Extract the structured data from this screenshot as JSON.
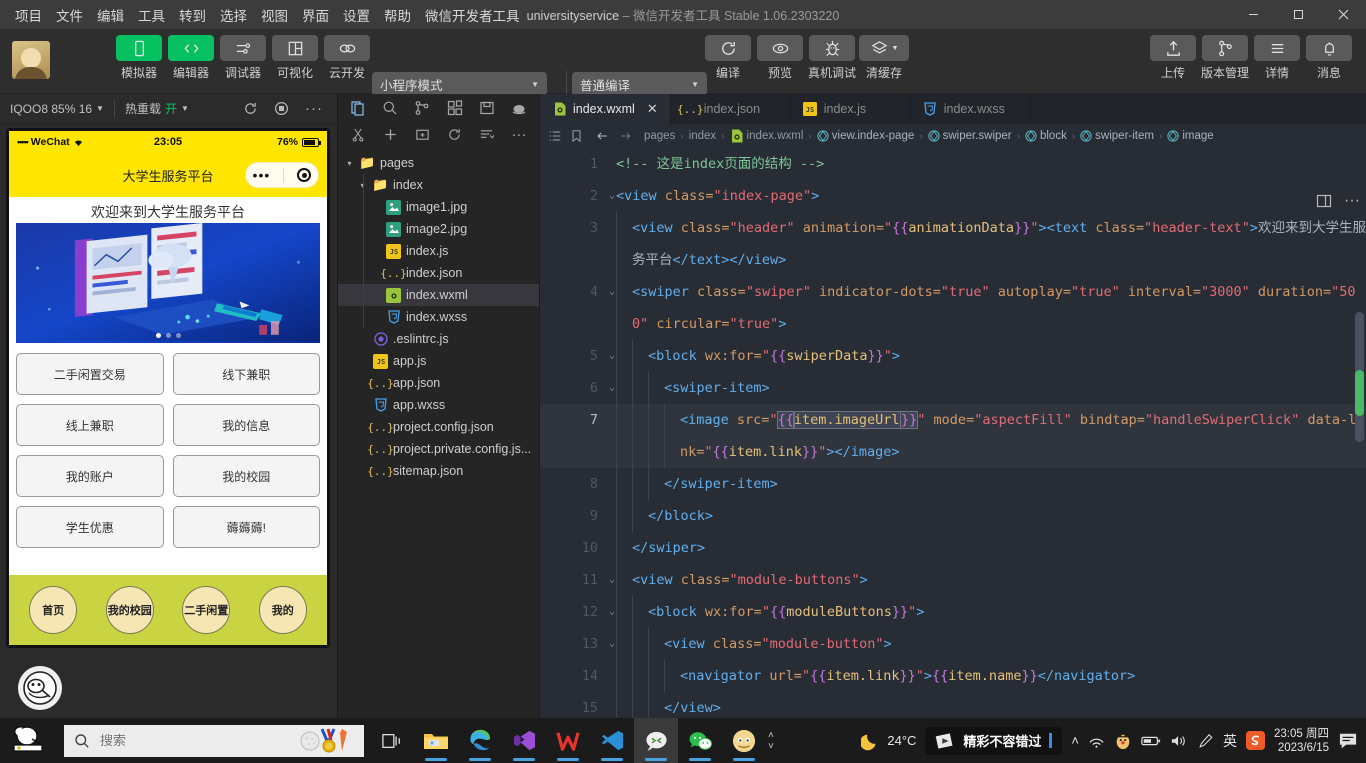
{
  "titlebar": {
    "menus": [
      "项目",
      "文件",
      "编辑",
      "工具",
      "转到",
      "选择",
      "视图",
      "界面",
      "设置",
      "帮助",
      "微信开发者工具"
    ],
    "project_name": "universityservice",
    "dash": "–",
    "app_name": "微信开发者工具",
    "version": "Stable 1.06.2303220",
    "minimize": "–",
    "maximize": "▢",
    "close": "✕"
  },
  "toolbar": {
    "items": [
      {
        "label": "模拟器",
        "icon": "phone-icon",
        "active": true
      },
      {
        "label": "编辑器",
        "icon": "code-icon",
        "active": true
      },
      {
        "label": "调试器",
        "icon": "sliders-icon",
        "active": false
      },
      {
        "label": "可视化",
        "icon": "layout-icon",
        "active": false
      },
      {
        "label": "云开发",
        "icon": "cloud-icon",
        "active": false
      }
    ],
    "mode_select": "小程序模式",
    "compile_select": "普通编译",
    "actions": [
      {
        "label": "编译",
        "icon": "refresh-icon"
      },
      {
        "label": "预览",
        "icon": "eye-icon"
      },
      {
        "label": "真机调试",
        "icon": "bug-icon"
      },
      {
        "label": "清缓存",
        "icon": "layers-icon"
      }
    ],
    "right_actions": [
      {
        "label": "上传",
        "icon": "upload-icon"
      },
      {
        "label": "版本管理",
        "icon": "branch-icon"
      },
      {
        "label": "详情",
        "icon": "menu-icon"
      },
      {
        "label": "消息",
        "icon": "bell-icon"
      }
    ]
  },
  "simulator": {
    "device": "IQOO8 85% 16",
    "hot_reload_label": "热重载",
    "hot_reload_value": "开",
    "icons": [
      "refresh-icon",
      "record-icon",
      "more-icon"
    ],
    "phone": {
      "status_carrier": "WeChat",
      "status_dots": "•••••",
      "status_time": "23:05",
      "battery_percent": "76%",
      "nav_title": "大学生服务平台",
      "welcome_text": "欢迎来到大学生服务平台",
      "swiper_dots": 3,
      "swiper_active": 0,
      "module_buttons": [
        "二手闲置交易",
        "线下兼职",
        "线上兼职",
        "我的信息",
        "我的账户",
        "我的校园",
        "学生优惠",
        "薅薅薅!"
      ],
      "tabbar": [
        "首页",
        "我的校园",
        "二手闲置",
        "我的"
      ]
    }
  },
  "file_tree": {
    "tools_row1": [
      "files-icon",
      "search-icon",
      "branch-icon",
      "extensions-icon",
      "save-icon",
      "debug-icon"
    ],
    "tools_row2": [
      "cut-icon",
      "new-file-icon",
      "new-folder-icon",
      "refresh-icon",
      "collapse-icon",
      "more-icon"
    ],
    "items": [
      {
        "label": "pages",
        "type": "folder",
        "depth": 0,
        "arrow": "▾"
      },
      {
        "label": "index",
        "type": "folder-o",
        "depth": 1,
        "arrow": "▾"
      },
      {
        "label": "image1.jpg",
        "type": "img",
        "depth": 2
      },
      {
        "label": "image2.jpg",
        "type": "img",
        "depth": 2
      },
      {
        "label": "index.js",
        "type": "js",
        "depth": 2
      },
      {
        "label": "index.json",
        "type": "json",
        "depth": 2
      },
      {
        "label": "index.wxml",
        "type": "wxml",
        "depth": 2,
        "active": true
      },
      {
        "label": "index.wxss",
        "type": "wxss",
        "depth": 2
      },
      {
        "label": ".eslintrc.js",
        "type": "eslint",
        "depth": 1
      },
      {
        "label": "app.js",
        "type": "js",
        "depth": 1
      },
      {
        "label": "app.json",
        "type": "json",
        "depth": 1
      },
      {
        "label": "app.wxss",
        "type": "wxss",
        "depth": 1
      },
      {
        "label": "project.config.json",
        "type": "json",
        "depth": 1
      },
      {
        "label": "project.private.config.js...",
        "type": "json",
        "depth": 1
      },
      {
        "label": "sitemap.json",
        "type": "json",
        "depth": 1
      }
    ]
  },
  "editor": {
    "tabs": [
      {
        "label": "index.wxml",
        "type": "wxml",
        "active": true,
        "close": "✕"
      },
      {
        "label": "index.json",
        "type": "json",
        "active": false
      },
      {
        "label": "index.js",
        "type": "js",
        "active": false
      },
      {
        "label": "index.wxss",
        "type": "wxss",
        "active": false
      }
    ],
    "breadcrumb_icons": [
      "outline-icon",
      "bookmark-icon",
      "back-arrow-icon",
      "forward-arrow-icon"
    ],
    "breadcrumb": [
      "pages",
      "index",
      "index.wxml",
      "view.index-page",
      "swiper.swiper",
      "block",
      "swiper-item",
      "image"
    ],
    "right_icons": [
      "split-editor-icon",
      "more-icon"
    ],
    "code_lines": [
      {
        "num": "1",
        "fold": "",
        "indent": 0,
        "highlight": false,
        "spans": [
          {
            "t": "<!-- ",
            "c": "t-com"
          },
          {
            "t": "这是index页面的结构 -->",
            "c": "t-com"
          }
        ]
      },
      {
        "num": "2",
        "fold": "⌄",
        "indent": 0,
        "highlight": false,
        "spans": [
          {
            "t": "<view",
            "c": "t-tag"
          },
          {
            "t": " class=",
            "c": "t-attr"
          },
          {
            "t": "\"index-page\"",
            "c": "t-str"
          },
          {
            "t": ">",
            "c": "t-tag"
          }
        ]
      },
      {
        "num": "3",
        "fold": "",
        "indent": 1,
        "highlight": false,
        "spans": [
          {
            "t": "<view",
            "c": "t-tag"
          },
          {
            "t": " class=",
            "c": "t-attr"
          },
          {
            "t": "\"header\"",
            "c": "t-str"
          },
          {
            "t": " animation=",
            "c": "t-attr"
          },
          {
            "t": "\"",
            "c": "t-str"
          },
          {
            "t": "{{",
            "c": "t-brace"
          },
          {
            "t": "animationData",
            "c": "t-var"
          },
          {
            "t": "}}",
            "c": "t-brace"
          },
          {
            "t": "\"",
            "c": "t-str"
          },
          {
            "t": ">",
            "c": "t-tag"
          },
          {
            "t": "<text",
            "c": "t-tag"
          },
          {
            "t": " class=",
            "c": "t-attr"
          },
          {
            "t": "\"header-text\"",
            "c": "t-str"
          },
          {
            "t": ">",
            "c": "t-tag"
          },
          {
            "t": "欢迎来到大学生服务平台",
            "c": "t-plain"
          },
          {
            "t": "</text>",
            "c": "t-tag"
          },
          {
            "t": "</view>",
            "c": "t-tag"
          }
        ]
      },
      {
        "num": "4",
        "fold": "⌄",
        "indent": 1,
        "highlight": false,
        "spans": [
          {
            "t": "<swiper",
            "c": "t-tag"
          },
          {
            "t": " class=",
            "c": "t-attr"
          },
          {
            "t": "\"swiper\"",
            "c": "t-str"
          },
          {
            "t": " indicator-dots=",
            "c": "t-attr"
          },
          {
            "t": "\"true\"",
            "c": "t-str"
          },
          {
            "t": " autoplay=",
            "c": "t-attr"
          },
          {
            "t": "\"true\"",
            "c": "t-str"
          },
          {
            "t": " interval=",
            "c": "t-attr"
          },
          {
            "t": "\"3000\"",
            "c": "t-str"
          },
          {
            "t": " duration=",
            "c": "t-attr"
          },
          {
            "t": "\"500\"",
            "c": "t-str"
          },
          {
            "t": " circular=",
            "c": "t-attr"
          },
          {
            "t": "\"true\"",
            "c": "t-str"
          },
          {
            "t": ">",
            "c": "t-tag"
          }
        ]
      },
      {
        "num": "5",
        "fold": "⌄",
        "indent": 2,
        "highlight": false,
        "spans": [
          {
            "t": "<block",
            "c": "t-tag"
          },
          {
            "t": " wx:for=",
            "c": "t-attr"
          },
          {
            "t": "\"",
            "c": "t-str"
          },
          {
            "t": "{{",
            "c": "t-brace"
          },
          {
            "t": "swiperData",
            "c": "t-var"
          },
          {
            "t": "}}",
            "c": "t-brace"
          },
          {
            "t": "\"",
            "c": "t-str"
          },
          {
            "t": ">",
            "c": "t-tag"
          }
        ]
      },
      {
        "num": "6",
        "fold": "⌄",
        "indent": 3,
        "highlight": false,
        "spans": [
          {
            "t": "<swiper-item>",
            "c": "t-tag"
          }
        ]
      },
      {
        "num": "7",
        "fold": "",
        "indent": 4,
        "highlight": true,
        "spans": [
          {
            "t": "<image",
            "c": "t-tag"
          },
          {
            "t": " src=",
            "c": "t-attr"
          },
          {
            "t": "\"",
            "c": "t-str"
          },
          {
            "t": "{{",
            "c": "t-brace",
            "sel": true
          },
          {
            "t": "item.imageUrl",
            "c": "t-var",
            "sel": true
          },
          {
            "t": "}}",
            "c": "t-brace",
            "sel": true
          },
          {
            "t": "\"",
            "c": "t-str"
          },
          {
            "t": " mode=",
            "c": "t-attr"
          },
          {
            "t": "\"aspectFill\"",
            "c": "t-str"
          },
          {
            "t": " bindtap=",
            "c": "t-attr"
          },
          {
            "t": "\"handleSwiperClick\"",
            "c": "t-str"
          },
          {
            "t": " data-link=",
            "c": "t-attr"
          },
          {
            "t": "\"",
            "c": "t-str"
          },
          {
            "t": "{{",
            "c": "t-brace"
          },
          {
            "t": "item.link",
            "c": "t-var"
          },
          {
            "t": "}}",
            "c": "t-brace"
          },
          {
            "t": "\"",
            "c": "t-str"
          },
          {
            "t": ">",
            "c": "t-tag"
          },
          {
            "t": "</image>",
            "c": "t-tag"
          }
        ]
      },
      {
        "num": "8",
        "fold": "",
        "indent": 3,
        "highlight": false,
        "spans": [
          {
            "t": "</swiper-item>",
            "c": "t-tag"
          }
        ]
      },
      {
        "num": "9",
        "fold": "",
        "indent": 2,
        "highlight": false,
        "spans": [
          {
            "t": "</block>",
            "c": "t-tag"
          }
        ]
      },
      {
        "num": "10",
        "fold": "",
        "indent": 1,
        "highlight": false,
        "spans": [
          {
            "t": "</swiper>",
            "c": "t-tag"
          }
        ]
      },
      {
        "num": "11",
        "fold": "⌄",
        "indent": 1,
        "highlight": false,
        "spans": [
          {
            "t": "<view",
            "c": "t-tag"
          },
          {
            "t": " class=",
            "c": "t-attr"
          },
          {
            "t": "\"module-buttons\"",
            "c": "t-str"
          },
          {
            "t": ">",
            "c": "t-tag"
          }
        ]
      },
      {
        "num": "12",
        "fold": "⌄",
        "indent": 2,
        "highlight": false,
        "spans": [
          {
            "t": "<block",
            "c": "t-tag"
          },
          {
            "t": " wx:for=",
            "c": "t-attr"
          },
          {
            "t": "\"",
            "c": "t-str"
          },
          {
            "t": "{{",
            "c": "t-brace"
          },
          {
            "t": "moduleButtons",
            "c": "t-var"
          },
          {
            "t": "}}",
            "c": "t-brace"
          },
          {
            "t": "\"",
            "c": "t-str"
          },
          {
            "t": ">",
            "c": "t-tag"
          }
        ]
      },
      {
        "num": "13",
        "fold": "⌄",
        "indent": 3,
        "highlight": false,
        "spans": [
          {
            "t": "<view",
            "c": "t-tag"
          },
          {
            "t": " class=",
            "c": "t-attr"
          },
          {
            "t": "\"module-button\"",
            "c": "t-str"
          },
          {
            "t": ">",
            "c": "t-tag"
          }
        ]
      },
      {
        "num": "14",
        "fold": "",
        "indent": 4,
        "highlight": false,
        "spans": [
          {
            "t": "<navigator",
            "c": "t-tag"
          },
          {
            "t": " url=",
            "c": "t-attr"
          },
          {
            "t": "\"",
            "c": "t-str"
          },
          {
            "t": "{{",
            "c": "t-brace"
          },
          {
            "t": "item.link",
            "c": "t-var"
          },
          {
            "t": "}}",
            "c": "t-brace"
          },
          {
            "t": "\"",
            "c": "t-str"
          },
          {
            "t": ">",
            "c": "t-tag"
          },
          {
            "t": "{{",
            "c": "t-brace"
          },
          {
            "t": "item.name",
            "c": "t-var"
          },
          {
            "t": "}}",
            "c": "t-brace"
          },
          {
            "t": "</navigator>",
            "c": "t-tag"
          }
        ]
      },
      {
        "num": "15",
        "fold": "",
        "indent": 3,
        "highlight": false,
        "spans": [
          {
            "t": "</view>",
            "c": "t-tag"
          }
        ]
      }
    ]
  },
  "taskbar": {
    "search_placeholder": "搜索",
    "apps": [
      "task-view-icon",
      "file-explorer-icon",
      "edge-icon",
      "visual-studio-icon",
      "wps-icon",
      "vscode-icon",
      "wechat-devtools-icon",
      "wechat-icon",
      "app-icon"
    ],
    "weather_temp": "24°C",
    "news_text": "精彩不容错过",
    "tray_icons": [
      "chevron-up-icon",
      "wifi-icon",
      "qq-icon",
      "battery-icon",
      "volume-icon",
      "pen-icon"
    ],
    "ime": "英",
    "sogou": "S",
    "time": "23:05 周四",
    "date": "2023/6/15",
    "notification": "notification-icon"
  }
}
